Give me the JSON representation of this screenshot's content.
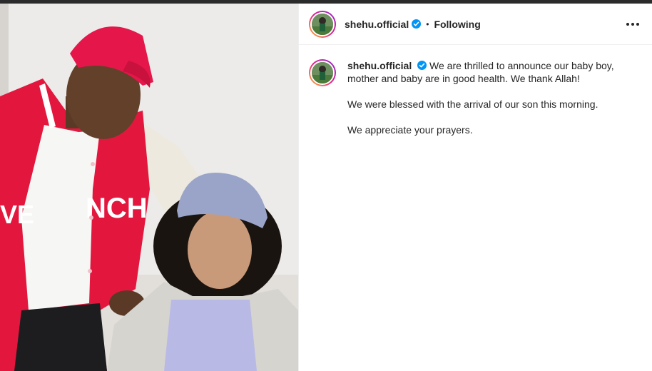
{
  "post": {
    "username": "shehu.official",
    "verified_icon": "verified-badge-icon",
    "separator": "•",
    "follow_status": "Following",
    "more_icon": "more-options-icon"
  },
  "caption": {
    "username": "shehu.official",
    "line1": "We are thrilled to announce our baby boy, mother and baby are in good health. We thank Allah!",
    "line2": "We were blessed with the arrival of our son this morning.",
    "line3": "We appreciate your prayers."
  },
  "photo": {
    "jacket_text": "NCH",
    "jacket_text_left": "VE"
  },
  "colors": {
    "verified_blue": "#0095f6",
    "jacket_red": "#e3173e",
    "story_ring": "#e3218c"
  }
}
